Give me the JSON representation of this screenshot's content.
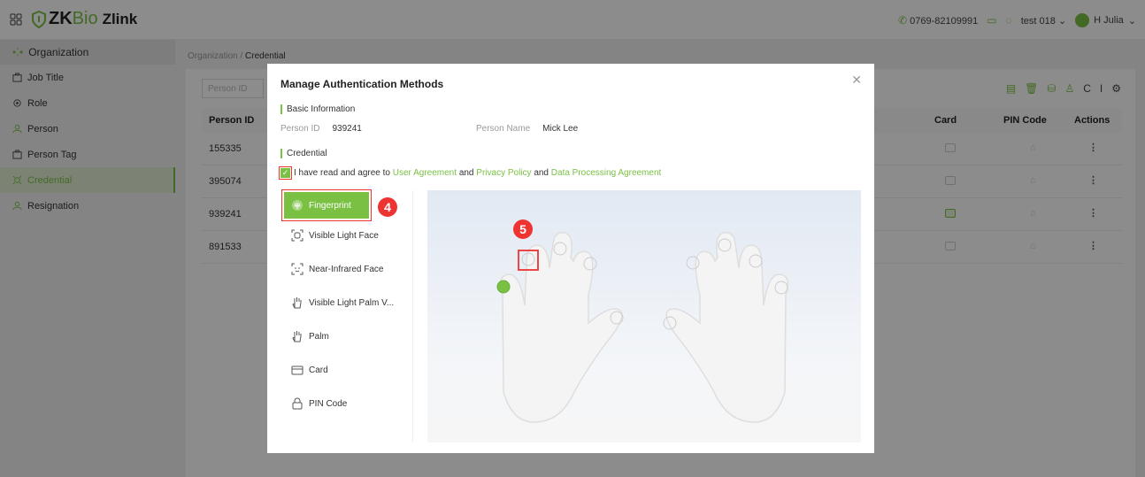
{
  "topbar": {
    "logo_brand": "ZK",
    "logo_bio": "Bio",
    "logo_product": "Zlink",
    "phone": "0769-82109991",
    "org": "test 018",
    "user": "H Julia"
  },
  "sidebar": {
    "header": "Organization",
    "items": [
      {
        "label": "Job Title"
      },
      {
        "label": "Role"
      },
      {
        "label": "Person"
      },
      {
        "label": "Person Tag"
      },
      {
        "label": "Credential",
        "active": true
      },
      {
        "label": "Resignation"
      }
    ]
  },
  "breadcrumb": {
    "parent": "Organization",
    "sep": "/",
    "current": "Credential"
  },
  "search": {
    "placeholder": "Person ID"
  },
  "table": {
    "columns": {
      "person_id": "Person ID",
      "card": "Card",
      "pin": "PIN Code",
      "actions": "Actions"
    },
    "rows": [
      {
        "person_id": "155335",
        "card_set": false
      },
      {
        "person_id": "395074",
        "card_set": false
      },
      {
        "person_id": "939241",
        "card_set": true
      },
      {
        "person_id": "891533",
        "card_set": false
      }
    ],
    "action_glyph": "⋮"
  },
  "dialog": {
    "title": "Manage Authentication Methods",
    "basic_section": "Basic Information",
    "person_id_label": "Person ID",
    "person_id": "939241",
    "person_name_label": "Person Name",
    "person_name": "Mick Lee",
    "credential_section": "Credential",
    "agree_text": "I have read and agree to",
    "user_agreement": "User Agreement",
    "and1": "and",
    "privacy_policy": "Privacy Policy",
    "and2": "and",
    "data_agreement": "Data Processing Agreement",
    "agreed": true,
    "methods": [
      {
        "label": "Fingerprint",
        "icon": "fingerprint-icon",
        "selected": true
      },
      {
        "label": "Visible Light Face",
        "icon": "face-scan-icon"
      },
      {
        "label": "Near-Infrared Face",
        "icon": "infrared-face-icon"
      },
      {
        "label": "Visible Light Palm V...",
        "icon": "palm-vein-icon"
      },
      {
        "label": "Palm",
        "icon": "palm-icon"
      },
      {
        "label": "Card",
        "icon": "card-icon"
      },
      {
        "label": "PIN Code",
        "icon": "lock-icon"
      }
    ],
    "registered_fingers": [
      "left-little"
    ],
    "callouts": {
      "step_a": "4",
      "step_b": "5"
    }
  },
  "colors": {
    "accent": "#7ac143",
    "callout": "#e33333",
    "overlay": "rgba(0,0,0,0.45)"
  }
}
